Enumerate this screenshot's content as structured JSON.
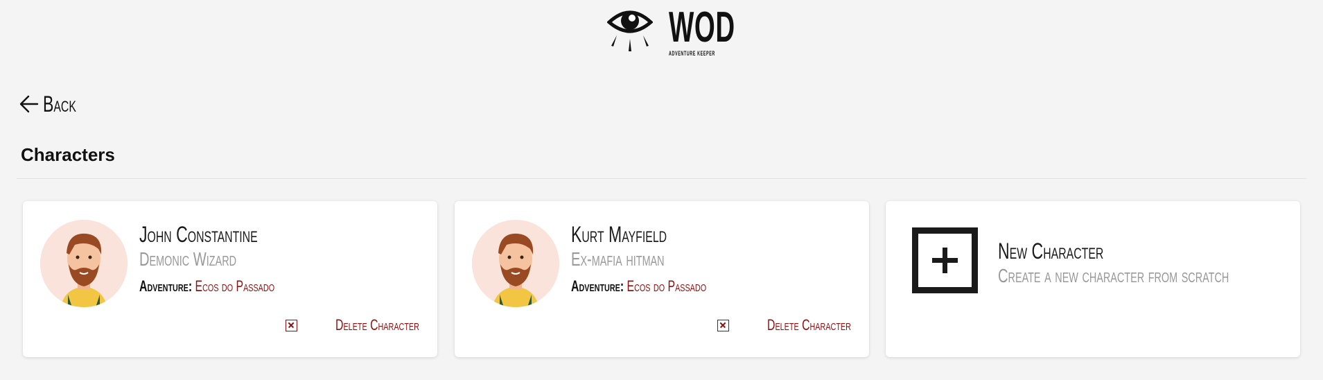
{
  "header": {
    "logo_word": "WOD",
    "logo_sub": "ADVENTURE KEEPER"
  },
  "nav": {
    "back_label": "Back"
  },
  "page": {
    "title": "Characters"
  },
  "characters": [
    {
      "name": "John Constantine",
      "role": "Demonic Wizard",
      "adventure_label": "Adventure:",
      "adventure_value": "Ecos do Passado",
      "delete_label": "Delete Character"
    },
    {
      "name": "Kurt Mayfield",
      "role": "Ex-mafia hitman",
      "adventure_label": "Adventure:",
      "adventure_value": "Ecos do Passado",
      "delete_label": "Delete Character"
    }
  ],
  "new_character": {
    "title": "New Character",
    "subtitle": "Create a new character from scratch"
  },
  "colors": {
    "accent": "#8b1010",
    "background": "#f4f4f4",
    "card": "#ffffff",
    "muted_text": "#999999"
  },
  "icons": [
    "eye-logo-icon",
    "arrow-left-icon",
    "avatar",
    "delete-x-icon",
    "plus-box-icon"
  ]
}
